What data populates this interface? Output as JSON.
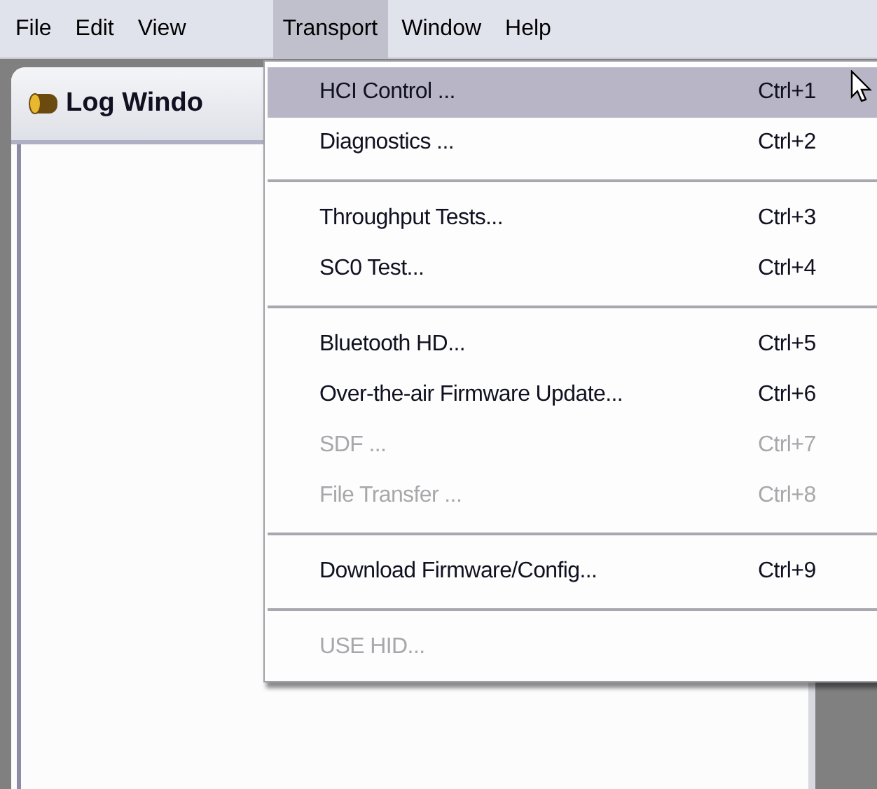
{
  "menubar": [
    {
      "label": "File",
      "selected": false
    },
    {
      "label": "Edit",
      "selected": false
    },
    {
      "label": "View",
      "selected": false
    },
    {
      "label": "Transport",
      "selected": true
    },
    {
      "label": "Window",
      "selected": false
    },
    {
      "label": "Help",
      "selected": false
    }
  ],
  "log_window": {
    "title": "Log Windo"
  },
  "menu": {
    "items": [
      {
        "kind": "item",
        "label": "HCI Control ...",
        "shortcut": "Ctrl+1",
        "selected": true,
        "disabled": false
      },
      {
        "kind": "item",
        "label": "Diagnostics ...",
        "shortcut": "Ctrl+2",
        "selected": false,
        "disabled": false
      },
      {
        "kind": "separator"
      },
      {
        "kind": "item",
        "label": "Throughput Tests...",
        "shortcut": "Ctrl+3",
        "selected": false,
        "disabled": false
      },
      {
        "kind": "item",
        "label": "SC0 Test...",
        "shortcut": "Ctrl+4",
        "selected": false,
        "disabled": false
      },
      {
        "kind": "separator"
      },
      {
        "kind": "item",
        "label": "Bluetooth HD...",
        "shortcut": "Ctrl+5",
        "selected": false,
        "disabled": false
      },
      {
        "kind": "item",
        "label": "Over-the-air Firmware Update...",
        "shortcut": "Ctrl+6",
        "selected": false,
        "disabled": false
      },
      {
        "kind": "item",
        "label": "SDF ...",
        "shortcut": "Ctrl+7",
        "selected": false,
        "disabled": true
      },
      {
        "kind": "item",
        "label": "File Transfer ...",
        "shortcut": "Ctrl+8",
        "selected": false,
        "disabled": true
      },
      {
        "kind": "separator"
      },
      {
        "kind": "item",
        "label": "Download Firmware/Config...",
        "shortcut": "Ctrl+9",
        "selected": false,
        "disabled": false
      },
      {
        "kind": "separator"
      },
      {
        "kind": "item",
        "label": "USE HID...",
        "selected": false,
        "disabled": true
      }
    ]
  }
}
